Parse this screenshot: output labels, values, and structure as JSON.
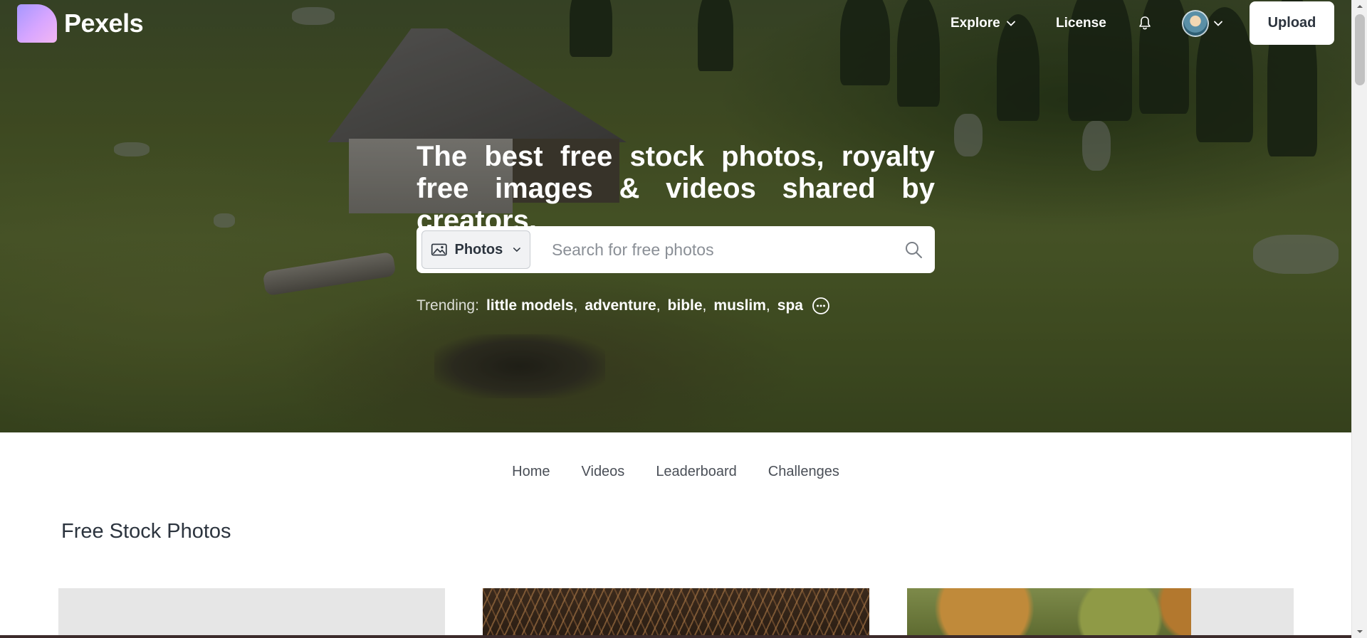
{
  "header": {
    "logo_text": "Pexels",
    "nav": {
      "explore": "Explore",
      "license": "License"
    },
    "upload_label": "Upload"
  },
  "hero": {
    "title": "The best free stock photos, royalty free images & videos shared by creators.",
    "search": {
      "type_label": "Photos",
      "placeholder": "Search for free photos"
    },
    "trending": {
      "label": "Trending:",
      "tags": [
        "little models",
        "adventure",
        "bible",
        "muslim",
        "spa"
      ]
    }
  },
  "tabs": [
    "Home",
    "Videos",
    "Leaderboard",
    "Challenges"
  ],
  "section_title": "Free Stock Photos",
  "colors": {
    "brand_gradient_start": "#a697ff",
    "brand_gradient_end": "#f2b6f2",
    "text_dark": "#2c343e",
    "placeholder": "#8a8f96"
  },
  "icons": [
    "image-icon",
    "chevron-down-icon",
    "search-icon",
    "bell-icon",
    "more-circle-icon"
  ]
}
